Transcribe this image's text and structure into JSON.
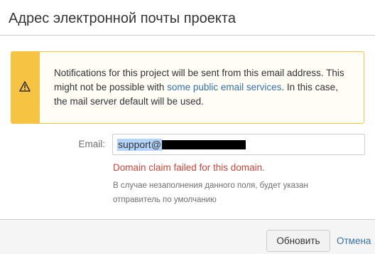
{
  "dialog": {
    "title": "Адрес электронной почты проекта"
  },
  "warning": {
    "icon": "warning-icon",
    "text_before": "Notifications for this project will be sent from this email address. This might not be possible with ",
    "link_text": "some public email services",
    "text_after": ". In this case, the mail server default will be used.",
    "colors": {
      "strip": "#f6c342",
      "link": "#3572b0"
    }
  },
  "form": {
    "email_label": "Email:",
    "email_value_visible": "support@",
    "error": "Domain claim failed for this domain.",
    "error_color": "#d04437",
    "hint": "В случае незаполнения данного поля, будет указан отправитель по умолчанию"
  },
  "footer": {
    "update_label": "Обновить",
    "cancel_label": "Отмена"
  }
}
